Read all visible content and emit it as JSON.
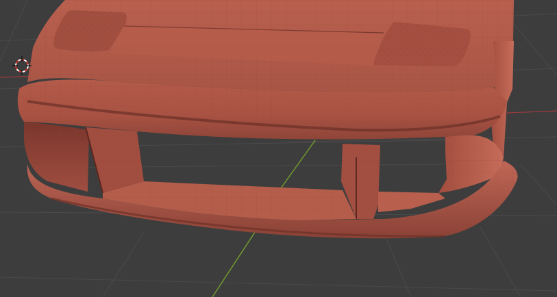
{
  "viewport": {
    "mode": "3d-viewport",
    "shading": "solid",
    "wireframe_overlay": true,
    "object": "car-front-bumper-mesh"
  },
  "colors": {
    "background": "#3d3d3d",
    "grid_line": "#4a4a4a",
    "x_axis": "#9e3a3f",
    "y_axis": "#6f9a2e",
    "mesh_base": "#b0584a",
    "mesh_light": "#c46a58",
    "mesh_dark": "#6e3128",
    "wire": "#8f4539",
    "cursor_red": "#d0332e",
    "cursor_white": "#ffffff"
  },
  "icons": {
    "cursor": "3d-cursor-icon"
  }
}
